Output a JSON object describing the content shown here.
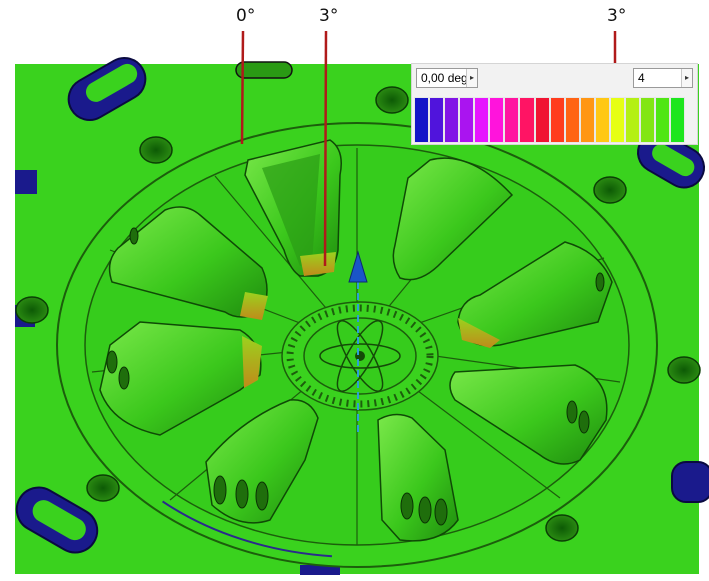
{
  "callouts": [
    {
      "text": "0°"
    },
    {
      "text": "3°"
    },
    {
      "text": "3°"
    }
  ],
  "panel": {
    "angle_value": "0,00 deg",
    "steps_value": "4",
    "spin_glyph": "▸"
  },
  "colormap": [
    "#1414c8",
    "#5014dc",
    "#8214e6",
    "#aa14f0",
    "#e614ff",
    "#ff14dc",
    "#ff14a0",
    "#ff1464",
    "#f01432",
    "#ff3c1e",
    "#ff6414",
    "#ff9614",
    "#ffc814",
    "#e6ff14",
    "#b4f014",
    "#82e614",
    "#50e614",
    "#1ee61e"
  ],
  "colors": {
    "surface": "#3ad21e",
    "dark_green": "#2b9c16",
    "steep_wall": "#1a1a8c",
    "leader": "#b01a1a"
  }
}
